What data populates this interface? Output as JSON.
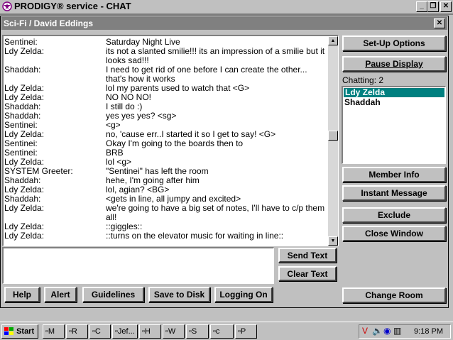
{
  "app": {
    "title": "PRODIGY® service - CHAT"
  },
  "chat_window": {
    "title": "Sci-Fi / David Eddings"
  },
  "transcript": [
    {
      "who": "Sentinei:",
      "text": "Saturday Night Live"
    },
    {
      "who": "Ldy Zelda:",
      "text": "its not a slanted smilie!!! its an impression of a smilie but it looks sad!!!"
    },
    {
      "who": "Shaddah:",
      "text": "I need to get rid of one before I can create the other... that's how it works"
    },
    {
      "who": "Ldy Zelda:",
      "text": "lol my parents used to watch that <G>"
    },
    {
      "who": "Ldy Zelda:",
      "text": "NO NO NO!"
    },
    {
      "who": "Shaddah:",
      "text": "I still do :)"
    },
    {
      "who": "Shaddah:",
      "text": "yes yes yes? <sg>"
    },
    {
      "who": "Sentinei:",
      "text": "<g>"
    },
    {
      "who": "Ldy Zelda:",
      "text": "no, 'cause err..I started it so I get to say! <G>"
    },
    {
      "who": "Sentinei:",
      "text": "Okay I'm going to the boards then to"
    },
    {
      "who": "Sentinei:",
      "text": "BRB"
    },
    {
      "who": "Ldy Zelda:",
      "text": "lol <g>"
    },
    {
      "who": "SYSTEM Greeter:",
      "text": "\"Sentinei\" has left the room"
    },
    {
      "who": "Shaddah:",
      "text": "hehe, I'm going after him"
    },
    {
      "who": "Ldy Zelda:",
      "text": "lol, agian? <BG>"
    },
    {
      "who": "Shaddah:",
      "text": "<gets in line, all jumpy and excited>"
    },
    {
      "who": "Ldy Zelda:",
      "text": "we're going to have a big set of notes, I'll have to c/p them all!"
    },
    {
      "who": "Ldy Zelda:",
      "text": "::giggles::"
    },
    {
      "who": "Ldy Zelda:",
      "text": "::turns on the elevator music for waiting in line::"
    }
  ],
  "transcript_scroll_position": 0.47,
  "input": {
    "value": ""
  },
  "side": {
    "setup": "Set-Up Options",
    "pause": "Pause Display",
    "chatting_label": "Chatting: 2",
    "users": [
      "Ldy Zelda",
      "Shaddah"
    ],
    "member_info": "Member Info",
    "instant_message": "Instant Message",
    "exclude": "Exclude",
    "close_window": "Close Window",
    "change_room": "Change Room"
  },
  "actions": {
    "send": "Send Text",
    "clear": "Clear Text",
    "help": "Help",
    "alert": "Alert",
    "guidelines": "Guidelines",
    "save": "Save to Disk",
    "logging": "Logging On"
  },
  "taskbar": {
    "start": "Start",
    "items": [
      "M",
      "R",
      "C",
      "Jef...",
      "H",
      "W",
      "S",
      "c",
      "P"
    ],
    "time": "9:18 PM"
  },
  "colors": {
    "selection": "#008080",
    "title_inactive": "#808080",
    "face": "#c0c0c0"
  }
}
